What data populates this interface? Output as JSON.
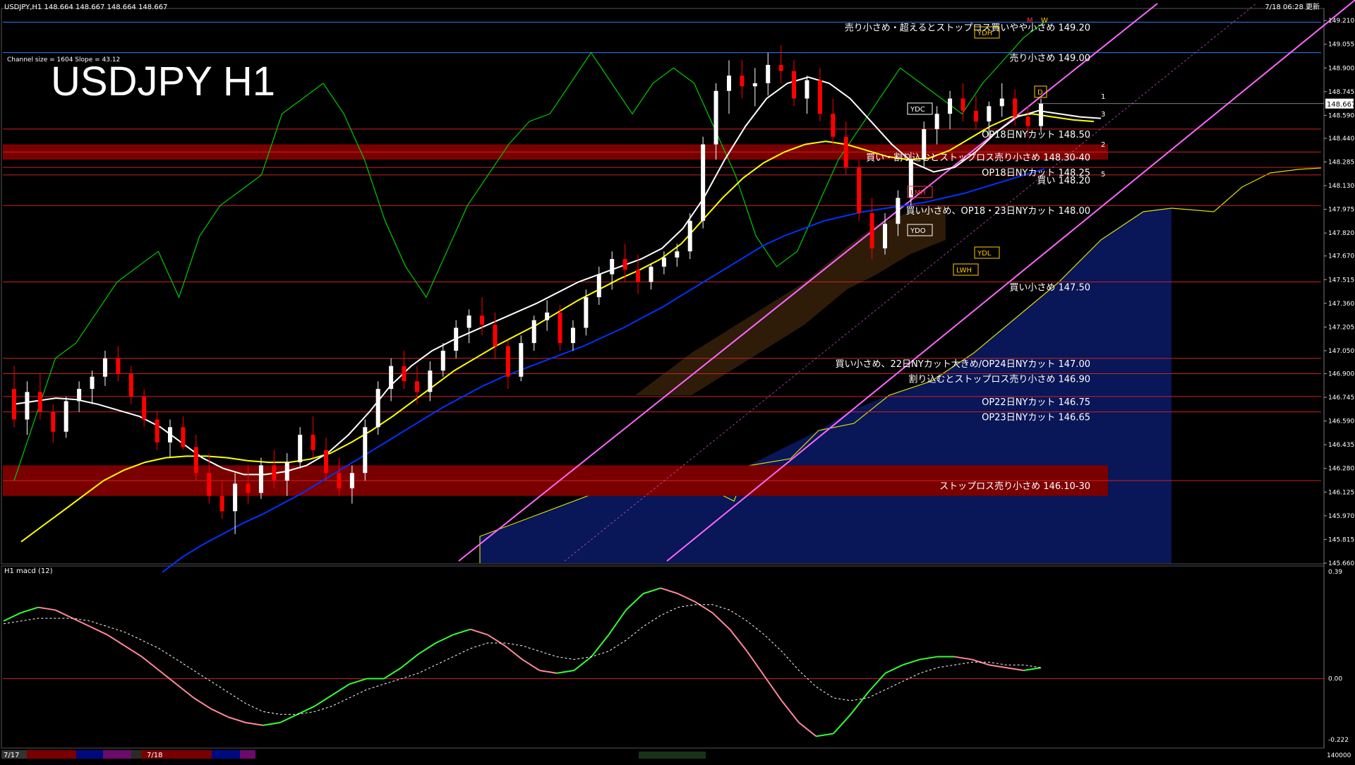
{
  "window": {
    "header_info": "USDJPY,H1  148.664 148.667 148.664 148.667",
    "timestamp": "7/18 06:28 更新",
    "channel_info": "Channel size = 1604 Slope = 43.12",
    "big_title": "USDJPY H1"
  },
  "colors": {
    "background": "#000000",
    "candle_up": "#ffffff",
    "candle_down": "#ff0000",
    "zone": "#7a0000",
    "sma_white": "#ffffff",
    "sma_yellow": "#ffff00",
    "sma_blue": "#0033ff",
    "chikou_green": "#00cc00",
    "channel_violet": "#ff66ff",
    "macd_green": "#33ff33",
    "macd_pink": "#ff8899",
    "kumo_blue": "#0a1a66"
  },
  "chart_data": {
    "type": "candlestick",
    "symbol": "USDJPY",
    "timeframe": "H1",
    "price_axis": {
      "ylim": [
        145.66,
        149.28
      ],
      "ticks": [
        "149.210",
        "149.055",
        "148.900",
        "148.745",
        "148.590",
        "148.440",
        "148.285",
        "148.130",
        "147.975",
        "147.820",
        "147.670",
        "147.515",
        "147.360",
        "147.205",
        "147.050",
        "146.900",
        "146.745",
        "146.590",
        "146.435",
        "146.280",
        "146.125",
        "145.970",
        "145.815",
        "145.660"
      ],
      "current_price": "148.667"
    },
    "levels": [
      {
        "price": 149.2,
        "label": "売り小さめ・超えるとストップロス買いやや小さめ 149.20"
      },
      {
        "price": 149.0,
        "label": "売り小さめ 149.00"
      },
      {
        "price": 148.5,
        "label": "OP18日NYカット 148.50"
      },
      {
        "price": 148.35,
        "label": "買い・割り込むとストップロス売り小さめ 148.30-40"
      },
      {
        "price": 148.25,
        "label": "OP18日NYカット 148.25"
      },
      {
        "price": 148.2,
        "label": "買い 148.20"
      },
      {
        "price": 148.0,
        "label": "買い小さめ、OP18・23日NYカット 148.00"
      },
      {
        "price": 147.5,
        "label": "買い小さめ 147.50"
      },
      {
        "price": 147.0,
        "label": "買い小さめ、22日NYカット大きめ/OP24日NYカット 147.00"
      },
      {
        "price": 146.9,
        "label": "割り込むとストップロス売り小さめ 146.90"
      },
      {
        "price": 146.75,
        "label": "OP22日NYカット 146.75"
      },
      {
        "price": 146.65,
        "label": "OP23日NYカット 146.65"
      },
      {
        "price": 146.2,
        "label": "ストップロス売り小さめ 146.10-30"
      }
    ],
    "zones": [
      {
        "from": 148.3,
        "to": 148.4
      },
      {
        "from": 146.1,
        "to": 146.3
      }
    ],
    "markers": [
      "YDH",
      "YDC",
      "YDO",
      "YDL",
      "LWH",
      "LMH",
      "M",
      "W",
      "D",
      "1",
      "2",
      "3",
      "5"
    ],
    "macd": {
      "label": "H1 macd (12)",
      "ticks": [
        "0.39",
        "0.00",
        "-0.222"
      ],
      "ylim": [
        -0.24,
        0.39
      ],
      "main": [
        0.21,
        0.24,
        0.26,
        0.25,
        0.22,
        0.19,
        0.16,
        0.12,
        0.08,
        0.03,
        -0.02,
        -0.07,
        -0.11,
        -0.14,
        -0.16,
        -0.17,
        -0.16,
        -0.13,
        -0.1,
        -0.06,
        -0.02,
        0.0,
        0.0,
        0.04,
        0.09,
        0.13,
        0.16,
        0.18,
        0.16,
        0.12,
        0.07,
        0.03,
        0.02,
        0.03,
        0.08,
        0.16,
        0.25,
        0.31,
        0.33,
        0.31,
        0.28,
        0.24,
        0.18,
        0.1,
        0.01,
        -0.08,
        -0.16,
        -0.21,
        -0.2,
        -0.13,
        -0.05,
        0.02,
        0.05,
        0.07,
        0.08,
        0.08,
        0.07,
        0.05,
        0.04,
        0.03,
        0.04
      ],
      "signal": [
        0.2,
        0.21,
        0.22,
        0.22,
        0.22,
        0.21,
        0.19,
        0.17,
        0.14,
        0.11,
        0.07,
        0.03,
        -0.01,
        -0.05,
        -0.09,
        -0.12,
        -0.13,
        -0.13,
        -0.12,
        -0.1,
        -0.07,
        -0.04,
        -0.02,
        0.0,
        0.02,
        0.05,
        0.08,
        0.11,
        0.13,
        0.13,
        0.12,
        0.1,
        0.08,
        0.07,
        0.08,
        0.1,
        0.14,
        0.19,
        0.23,
        0.26,
        0.27,
        0.27,
        0.25,
        0.21,
        0.16,
        0.1,
        0.03,
        -0.03,
        -0.07,
        -0.08,
        -0.07,
        -0.04,
        -0.01,
        0.02,
        0.04,
        0.05,
        0.06,
        0.06,
        0.05,
        0.05,
        0.04
      ]
    },
    "time_axis": {
      "ticks": [
        "7/17",
        "7/18"
      ],
      "bottom_ticks": [
        "140000"
      ]
    },
    "candles": [
      [
        146.8,
        146.95,
        146.55,
        146.6
      ],
      [
        146.6,
        146.85,
        146.5,
        146.78
      ],
      [
        146.78,
        146.9,
        146.6,
        146.65
      ],
      [
        146.65,
        146.7,
        146.45,
        146.52
      ],
      [
        146.52,
        146.75,
        146.48,
        146.72
      ],
      [
        146.72,
        146.85,
        146.65,
        146.8
      ],
      [
        146.8,
        146.92,
        146.7,
        146.88
      ],
      [
        146.88,
        147.05,
        146.82,
        147.0
      ],
      [
        147.0,
        147.08,
        146.85,
        146.9
      ],
      [
        146.9,
        146.95,
        146.7,
        146.75
      ],
      [
        146.75,
        146.8,
        146.55,
        146.6
      ],
      [
        146.6,
        146.65,
        146.4,
        146.45
      ],
      [
        146.45,
        146.6,
        146.35,
        146.55
      ],
      [
        146.55,
        146.62,
        146.4,
        146.42
      ],
      [
        146.42,
        146.5,
        146.2,
        146.25
      ],
      [
        146.25,
        146.38,
        146.05,
        146.1
      ],
      [
        146.1,
        146.2,
        145.95,
        146.0
      ],
      [
        146.0,
        146.25,
        145.85,
        146.18
      ],
      [
        146.18,
        146.3,
        146.05,
        146.12
      ],
      [
        146.12,
        146.35,
        146.08,
        146.3
      ],
      [
        146.3,
        146.4,
        146.15,
        146.2
      ],
      [
        146.2,
        146.38,
        146.1,
        146.32
      ],
      [
        146.32,
        146.55,
        146.28,
        146.5
      ],
      [
        146.5,
        146.62,
        146.35,
        146.4
      ],
      [
        146.4,
        146.48,
        146.2,
        146.25
      ],
      [
        146.25,
        146.35,
        146.1,
        146.15
      ],
      [
        146.15,
        146.3,
        146.05,
        146.25
      ],
      [
        146.25,
        146.6,
        146.2,
        146.55
      ],
      [
        146.55,
        146.85,
        146.5,
        146.8
      ],
      [
        146.8,
        147.0,
        146.72,
        146.95
      ],
      [
        146.95,
        147.05,
        146.8,
        146.85
      ],
      [
        146.85,
        146.95,
        146.7,
        146.78
      ],
      [
        146.78,
        146.98,
        146.72,
        146.92
      ],
      [
        146.92,
        147.1,
        146.88,
        147.05
      ],
      [
        147.05,
        147.25,
        147.0,
        147.2
      ],
      [
        147.2,
        147.32,
        147.1,
        147.28
      ],
      [
        147.28,
        147.4,
        147.15,
        147.22
      ],
      [
        147.22,
        147.3,
        147.0,
        147.08
      ],
      [
        147.08,
        147.12,
        146.8,
        146.88
      ],
      [
        146.88,
        147.15,
        146.85,
        147.1
      ],
      [
        147.1,
        147.28,
        147.05,
        147.25
      ],
      [
        147.25,
        147.38,
        147.18,
        147.3
      ],
      [
        147.3,
        147.35,
        147.05,
        147.1
      ],
      [
        147.1,
        147.25,
        147.05,
        147.2
      ],
      [
        147.2,
        147.45,
        147.15,
        147.4
      ],
      [
        147.4,
        147.6,
        147.35,
        147.55
      ],
      [
        147.55,
        147.7,
        147.45,
        147.65
      ],
      [
        147.65,
        147.75,
        147.5,
        147.58
      ],
      [
        147.58,
        147.68,
        147.42,
        147.5
      ],
      [
        147.5,
        147.62,
        147.45,
        147.6
      ],
      [
        147.6,
        147.7,
        147.55,
        147.66
      ],
      [
        147.66,
        147.75,
        147.6,
        147.7
      ],
      [
        147.7,
        147.95,
        147.65,
        147.9
      ],
      [
        147.9,
        148.45,
        147.85,
        148.4
      ],
      [
        148.4,
        148.8,
        148.3,
        148.75
      ],
      [
        148.75,
        148.95,
        148.6,
        148.85
      ],
      [
        148.85,
        148.95,
        148.7,
        148.78
      ],
      [
        148.78,
        148.9,
        148.65,
        148.8
      ],
      [
        148.8,
        149.0,
        148.72,
        148.92
      ],
      [
        148.92,
        149.05,
        148.8,
        148.88
      ],
      [
        148.88,
        148.95,
        148.65,
        148.7
      ],
      [
        148.7,
        148.85,
        148.6,
        148.82
      ],
      [
        148.82,
        148.9,
        148.55,
        148.6
      ],
      [
        148.6,
        148.7,
        148.4,
        148.45
      ],
      [
        148.45,
        148.55,
        148.2,
        148.25
      ],
      [
        148.25,
        148.3,
        147.9,
        147.95
      ],
      [
        147.95,
        148.05,
        147.65,
        147.72
      ],
      [
        147.72,
        147.95,
        147.68,
        147.88
      ],
      [
        147.88,
        148.1,
        147.8,
        148.05
      ],
      [
        148.05,
        148.35,
        148.0,
        148.3
      ],
      [
        148.3,
        148.55,
        148.25,
        148.5
      ],
      [
        148.5,
        148.65,
        148.4,
        148.6
      ],
      [
        148.6,
        148.75,
        148.5,
        148.7
      ],
      [
        148.7,
        148.8,
        148.55,
        148.62
      ],
      [
        148.62,
        148.72,
        148.5,
        148.55
      ],
      [
        148.55,
        148.68,
        148.45,
        148.65
      ],
      [
        148.65,
        148.8,
        148.58,
        148.7
      ],
      [
        148.7,
        148.76,
        148.52,
        148.58
      ],
      [
        148.58,
        148.65,
        148.45,
        148.52
      ],
      [
        148.52,
        148.7,
        148.48,
        148.667
      ]
    ],
    "sma_white": [
      146.7,
      146.72,
      146.74,
      146.73,
      146.7,
      146.66,
      146.62,
      146.55,
      146.45,
      146.35,
      146.28,
      146.24,
      146.24,
      146.26,
      146.3,
      146.38,
      146.5,
      146.65,
      146.82,
      146.95,
      147.05,
      147.12,
      147.18,
      147.24,
      147.3,
      147.36,
      147.43,
      147.5,
      147.55,
      147.6,
      147.65,
      147.72,
      147.85,
      148.05,
      148.3,
      148.52,
      148.7,
      148.8,
      148.84,
      148.8,
      148.7,
      148.55,
      148.4,
      148.28,
      148.22,
      148.25,
      148.35,
      148.48,
      148.58,
      148.62,
      148.6,
      148.58,
      148.57
    ],
    "sma_yellow": [
      145.8,
      145.9,
      146.0,
      146.1,
      146.2,
      146.27,
      146.32,
      146.35,
      146.36,
      146.36,
      146.35,
      146.33,
      146.32,
      146.32,
      146.34,
      146.38,
      146.45,
      146.53,
      146.62,
      146.72,
      146.82,
      146.92,
      147.0,
      147.08,
      147.15,
      147.22,
      147.3,
      147.38,
      147.45,
      147.52,
      147.58,
      147.65,
      147.75,
      147.9,
      148.05,
      148.18,
      148.28,
      148.35,
      148.4,
      148.42,
      148.4,
      148.36,
      148.32,
      148.3,
      148.31,
      148.36,
      148.44,
      148.52,
      148.58,
      148.6,
      148.58,
      148.56,
      148.55
    ],
    "sma_blue": [
      145.6,
      145.7,
      145.78,
      145.85,
      145.92,
      145.98,
      146.05,
      146.12,
      146.2,
      146.28,
      146.36,
      146.44,
      146.52,
      146.6,
      146.68,
      146.75,
      146.82,
      146.88,
      146.93,
      146.98,
      147.03,
      147.08,
      147.14,
      147.2,
      147.27,
      147.34,
      147.42,
      147.5,
      147.58,
      147.66,
      147.74,
      147.8,
      147.85,
      147.9,
      147.93,
      147.96,
      147.98,
      148.0,
      148.02,
      148.05,
      148.08,
      148.12,
      148.16,
      148.2,
      148.24
    ],
    "chikou_green": [
      146.2,
      146.6,
      147.0,
      147.1,
      147.3,
      147.5,
      147.6,
      147.7,
      147.4,
      147.8,
      148.0,
      148.1,
      148.2,
      148.6,
      148.7,
      148.8,
      148.6,
      148.3,
      147.9,
      147.6,
      147.4,
      147.7,
      148.0,
      148.2,
      148.4,
      148.55,
      148.6,
      148.8,
      149.0,
      148.8,
      148.6,
      148.8,
      148.9,
      148.8,
      148.5,
      148.2,
      147.8,
      147.6,
      147.7,
      148.0,
      148.3,
      148.5,
      148.7,
      148.9,
      148.8,
      148.7,
      148.6,
      148.8,
      148.95,
      149.1,
      149.2
    ]
  }
}
